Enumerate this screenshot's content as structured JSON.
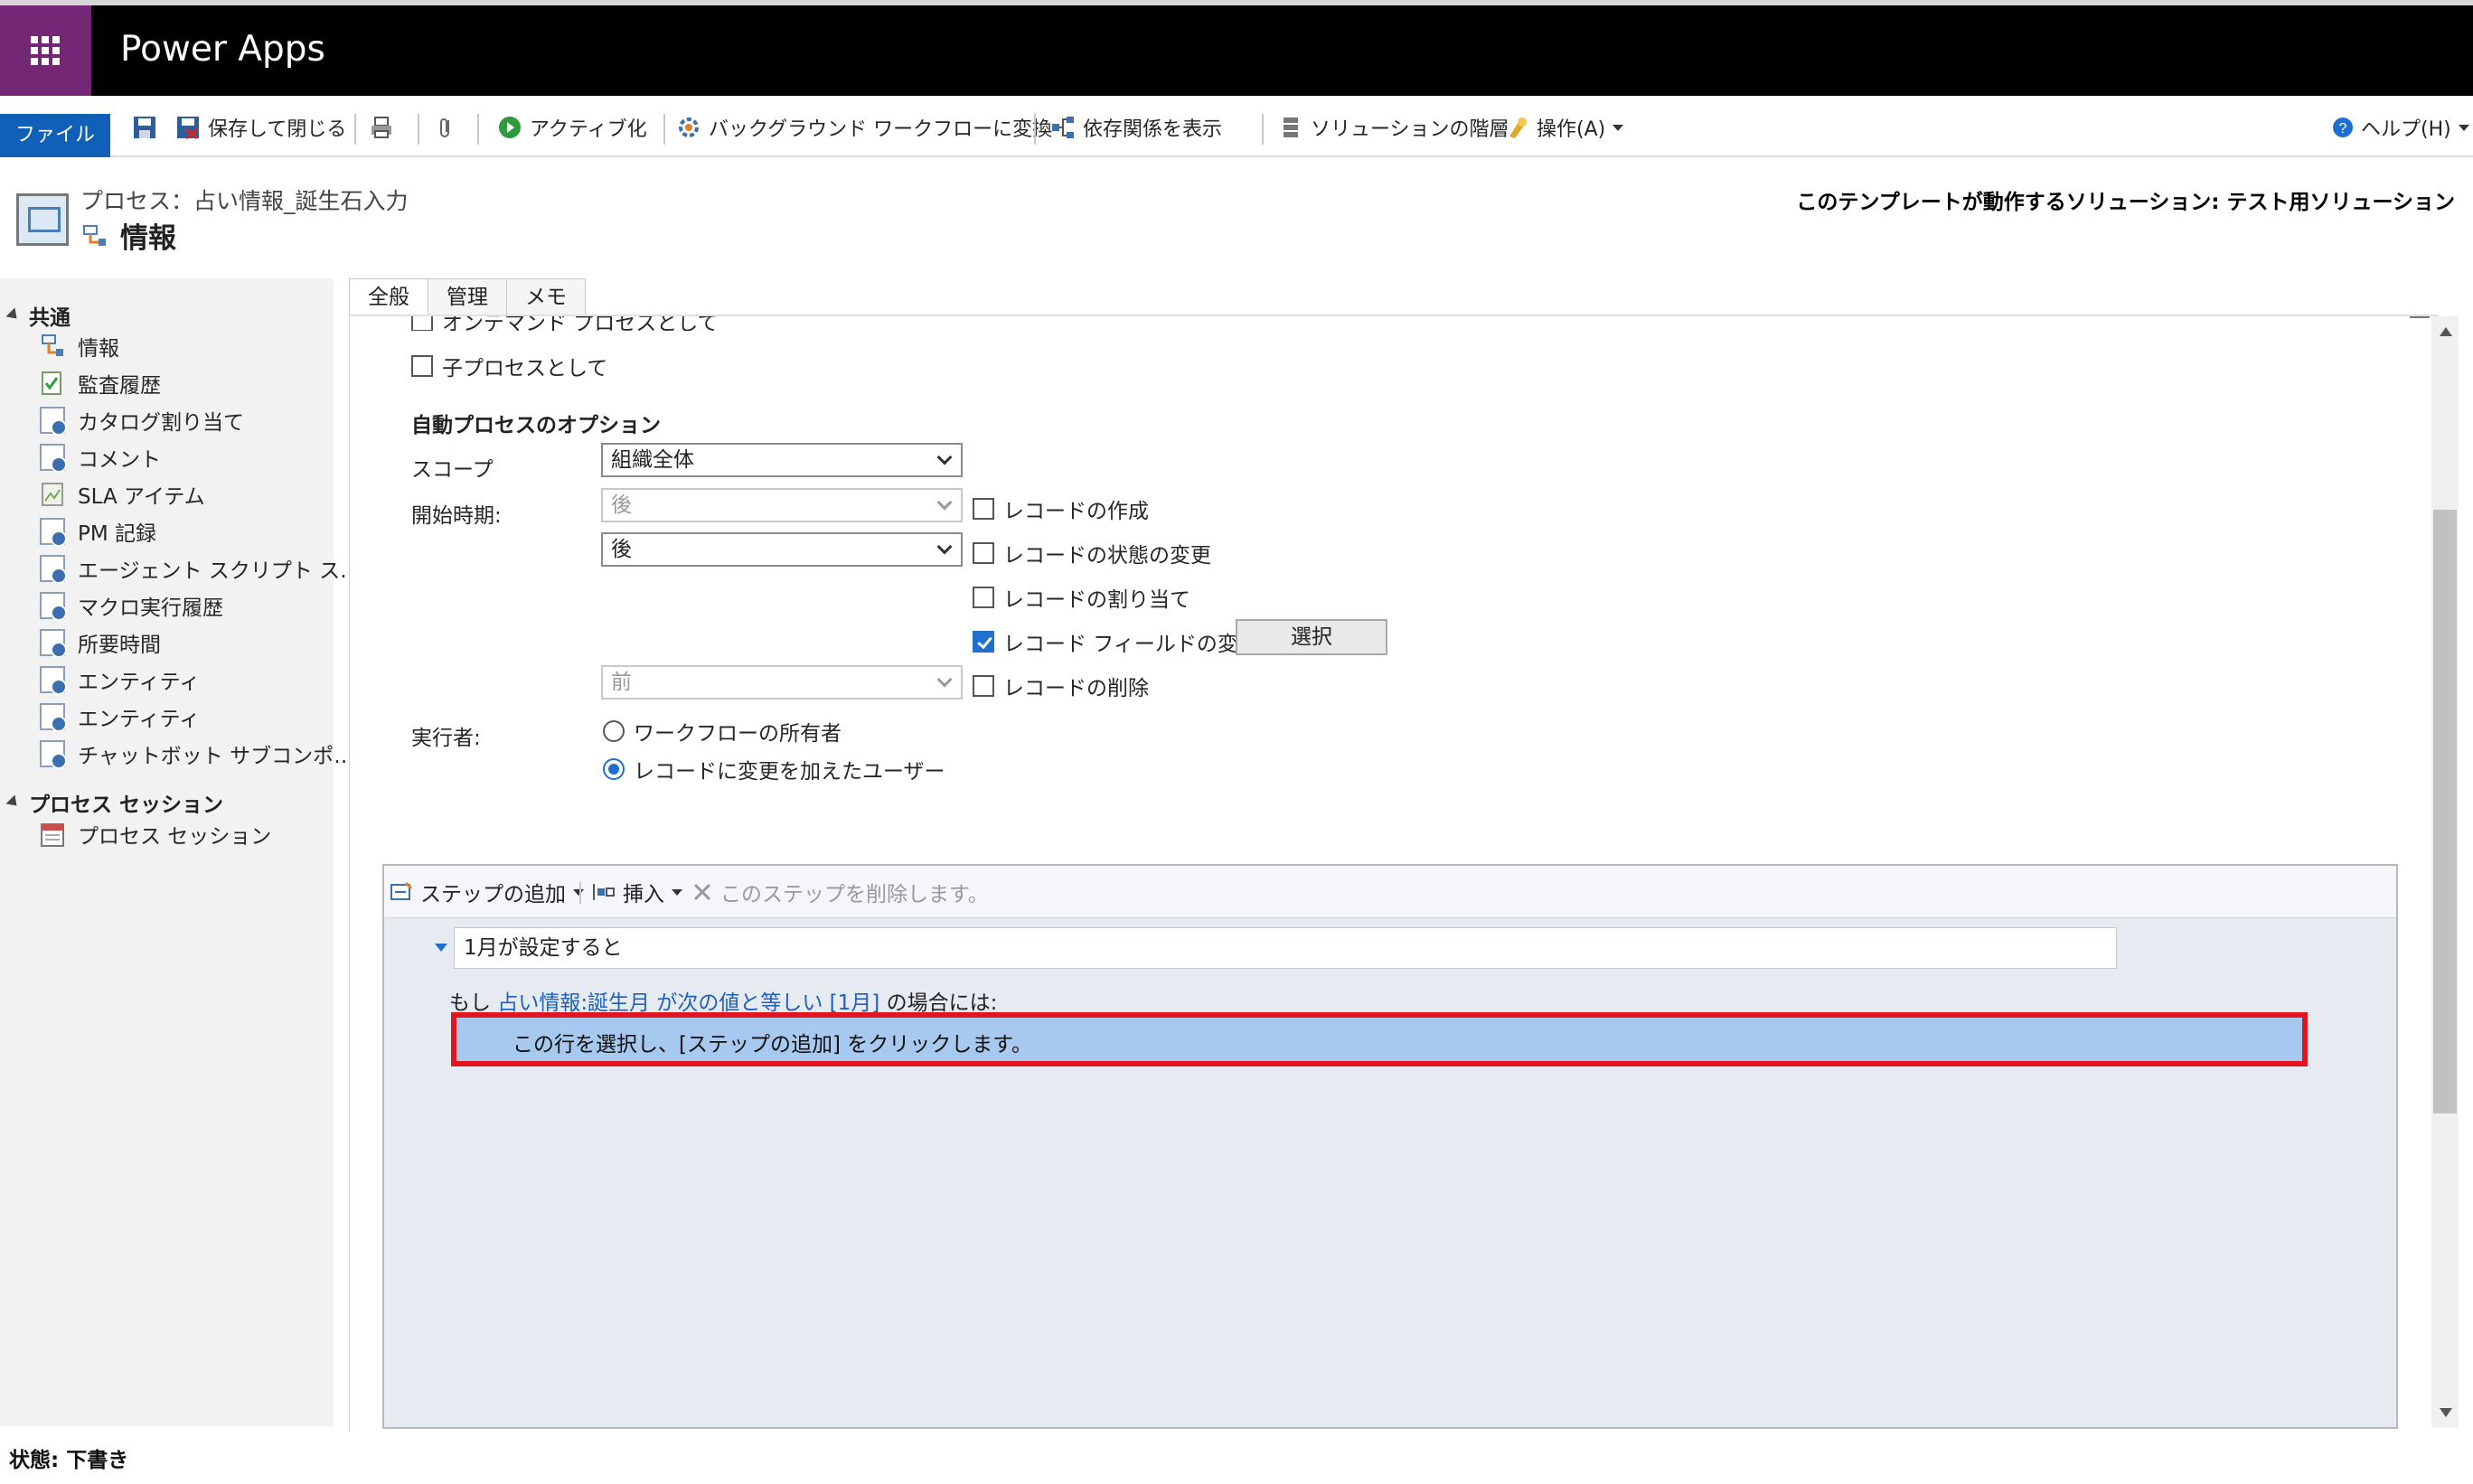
{
  "app": {
    "name": "Power Apps"
  },
  "ribbon": {
    "file_tab": "ファイル",
    "save_close": "保存して閉じる",
    "activate": "アクティブ化",
    "convert_background": "バックグラウンド ワークフローに変換",
    "show_dependencies": "依存関係を表示",
    "solution_layers": "ソリューションの階層",
    "actions": "操作(A)",
    "help": "ヘルプ(H)"
  },
  "page": {
    "breadcrumb": "プロセス：占い情報_誕生石入力",
    "title": "情報",
    "solution_label": "このテンプレートが動作するソリューション: テスト用ソリューション"
  },
  "nav": {
    "group_common": "共通",
    "items": [
      {
        "label": "情報",
        "icon": "process-icon"
      },
      {
        "label": "監査履歴",
        "icon": "audit-icon"
      },
      {
        "label": "カタログ割り当て",
        "icon": "document-icon"
      },
      {
        "label": "コメント",
        "icon": "document-icon"
      },
      {
        "label": "SLA アイテム",
        "icon": "sla-icon"
      },
      {
        "label": "PM 記録",
        "icon": "document-icon"
      },
      {
        "label": "エージェント スクリプト ス…",
        "icon": "document-icon"
      },
      {
        "label": "マクロ実行履歴",
        "icon": "document-icon"
      },
      {
        "label": "所要時間",
        "icon": "document-icon"
      },
      {
        "label": "エンティティ",
        "icon": "document-icon"
      },
      {
        "label": "エンティティ",
        "icon": "document-icon"
      },
      {
        "label": "チャットボット サブコンポ…",
        "icon": "document-icon"
      }
    ],
    "group_sessions": "プロセス セッション",
    "session_item": "プロセス セッション"
  },
  "tabs": [
    "全般",
    "管理",
    "メモ"
  ],
  "form": {
    "on_demand": "オンデマンド プロセスとして",
    "child_process": "子プロセスとして",
    "auto_options_title": "自動プロセスのオプション",
    "scope_label": "スコープ",
    "scope_value": "組織全体",
    "start_label": "開始時期:",
    "start_rows": [
      {
        "select": "後",
        "enabled": false,
        "check": "レコードの作成",
        "checked": false
      },
      {
        "select": "後",
        "enabled": true,
        "check": "レコードの状態の変更",
        "checked": false
      },
      {
        "select": "",
        "enabled": false,
        "check": "レコードの割り当て",
        "checked": false
      },
      {
        "select": "",
        "enabled": false,
        "check": "レコード フィールドの変更",
        "checked": true
      },
      {
        "select": "前",
        "enabled": false,
        "check": "レコードの削除",
        "checked": false
      }
    ],
    "select_button": "選択",
    "runner_label": "実行者:",
    "runner_options": [
      {
        "label": "ワークフローの所有者",
        "selected": false
      },
      {
        "label": "レコードに変更を加えたユーザー",
        "selected": true
      }
    ]
  },
  "designer": {
    "add_step": "ステップの追加",
    "insert": "挿入",
    "delete_step": "このステップを削除します。",
    "step_name": "1月が設定すると",
    "cond_prefix": "もし",
    "cond_link": "占い情報:誕生月 が次の値と等しい [1月]",
    "cond_suffix": "の場合には:",
    "placeholder_row": "この行を選択し、[ステップの追加] をクリックします。"
  },
  "status": {
    "text": "状態: 下書き"
  }
}
